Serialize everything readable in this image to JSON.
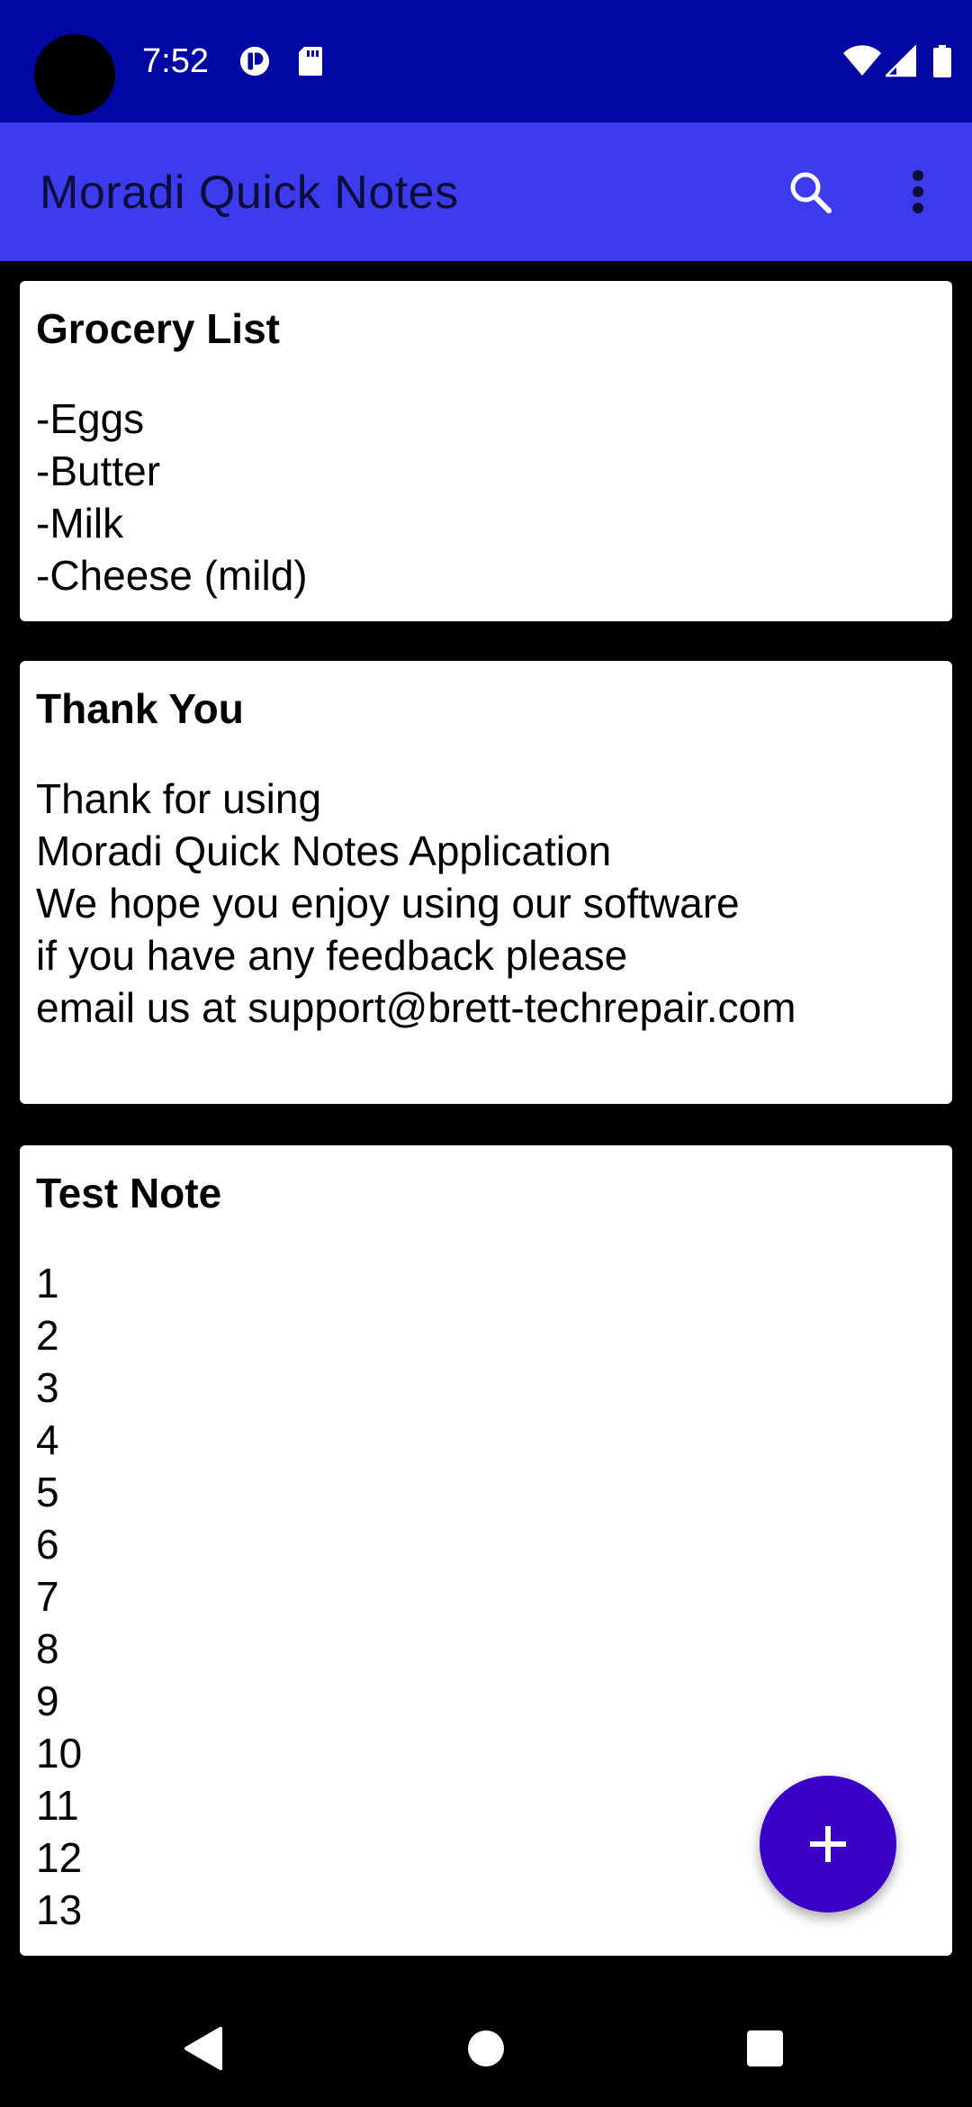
{
  "status_bar": {
    "time": "7:52",
    "icons": [
      "camera-cutout",
      "app-notification-icon",
      "sd-card-icon",
      "wifi-icon",
      "signal-icon",
      "battery-icon"
    ],
    "background": "#0107a0"
  },
  "app_bar": {
    "title": "Moradi Quick Notes",
    "actions": [
      "search-icon",
      "more-vert-icon"
    ],
    "background": "#3c3cee"
  },
  "notes": [
    {
      "title": "Grocery List",
      "body": "-Eggs\n-Butter\n-Milk\n-Cheese (mild)"
    },
    {
      "title": "Thank You",
      "body": "Thank for using\nMoradi Quick Notes Application\nWe hope you enjoy using our software\nif you have any feedback please\nemail us at support@brett-techrepair.com"
    },
    {
      "title": "Test Note",
      "body": "1\n2\n3\n4\n5\n6\n7\n8\n9\n10\n11\n12\n13"
    }
  ],
  "fab": {
    "icon": "plus-icon",
    "color": "#3a00c8"
  },
  "nav_bar": {
    "buttons": [
      "back-icon",
      "home-icon",
      "recents-icon"
    ]
  }
}
